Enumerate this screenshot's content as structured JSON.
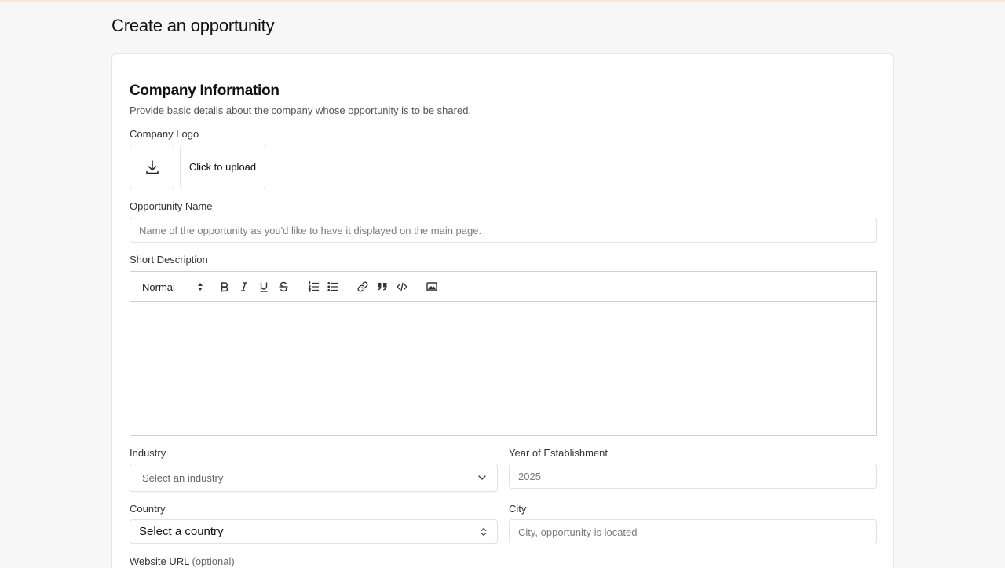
{
  "page": {
    "title": "Create an opportunity"
  },
  "company_section": {
    "title": "Company Information",
    "subtitle": "Provide basic details about the company whose opportunity is to be shared."
  },
  "logo": {
    "label": "Company Logo",
    "upload_label": "Click to upload",
    "icon": "download-icon"
  },
  "opportunity_name": {
    "label": "Opportunity Name",
    "value": "",
    "placeholder": "Name of the opportunity as you'd like to have it displayed on the main page."
  },
  "short_description": {
    "label": "Short Description",
    "format_selected": "Normal",
    "toolbar_icons": [
      "bold-icon",
      "italic-icon",
      "underline-icon",
      "strikethrough-icon",
      "ordered-list-icon",
      "bullet-list-icon",
      "link-icon",
      "blockquote-icon",
      "code-icon",
      "image-icon"
    ],
    "value": ""
  },
  "industry": {
    "label": "Industry",
    "placeholder": "Select an industry"
  },
  "year": {
    "label": "Year of Establishment",
    "value": "",
    "placeholder": "2025"
  },
  "country": {
    "label": "Country",
    "selected": "Select a country"
  },
  "city": {
    "label": "City",
    "value": "",
    "placeholder": "City, opportunity is located"
  },
  "website": {
    "label": "Website URL",
    "optional": "(optional)"
  },
  "colors": {
    "background": "#f7f7f7",
    "card": "#ffffff",
    "border": "#e3e3e3",
    "accent_top": "#fde7cf"
  }
}
